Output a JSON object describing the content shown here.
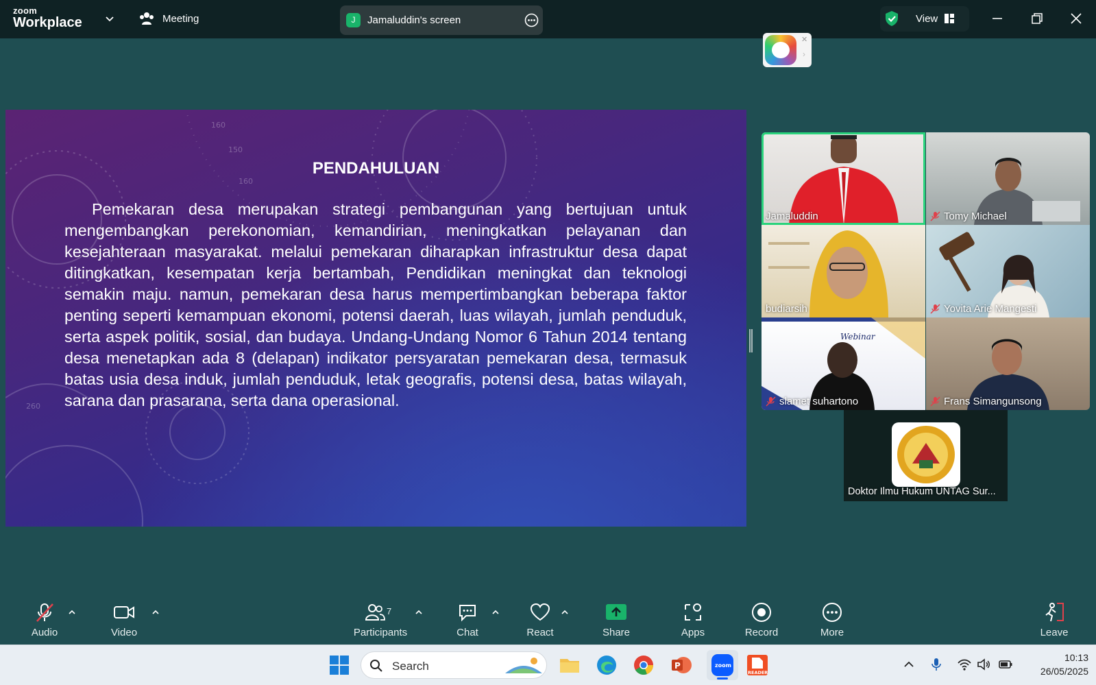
{
  "titlebar": {
    "logo_line1": "zoom",
    "logo_line2": "Workplace",
    "meeting_label": "Meeting",
    "share_badge": "J",
    "share_title": "Jamaluddin's screen",
    "view_label": "View"
  },
  "slide": {
    "title": "PENDAHULUAN",
    "body": "Pemekaran desa merupakan strategi pembangunan yang bertujuan untuk mengembangkan perekonomian, kemandirian, meningkatkan pelayanan dan kesejahteraan masyarakat. melalui pemekaran diharapkan infrastruktur desa dapat ditingkatkan, kesempatan kerja bertambah, Pendidikan meningkat dan teknologi semakin maju. namun, pemekaran desa harus mempertimbangkan beberapa faktor penting seperti kemampuan ekonomi, potensi daerah, luas wilayah, jumlah penduduk, serta aspek politik, sosial, dan budaya. Undang-Undang Nomor 6 Tahun 2014 tentang desa menetapkan ada 8 (delapan) indikator persyaratan pemekaran desa, termasuk batas usia desa induk, jumlah penduduk, letak geografis, potensi desa, batas wilayah, sarana dan prasarana, serta dana operasional.",
    "deco_numbers": [
      "160",
      "150",
      "160",
      "260"
    ]
  },
  "participants": [
    {
      "name": "Jamaluddin",
      "muted": false,
      "active": true
    },
    {
      "name": "Tomy Michael",
      "muted": true,
      "active": false
    },
    {
      "name": "budiarsih",
      "muted": false,
      "active": false
    },
    {
      "name": "Yovita Arie Mangesti",
      "muted": true,
      "active": false
    },
    {
      "name": "slamet suhartono",
      "muted": true,
      "active": false
    },
    {
      "name": "Frans Simangunsong",
      "muted": true,
      "active": false
    },
    {
      "name": "Doktor Ilmu Hukum UNTAG Sur...",
      "muted": false,
      "active": false
    }
  ],
  "webinar_tile_text": "Webinar",
  "toolbar": {
    "audio": "Audio",
    "video": "Video",
    "participants": "Participants",
    "participants_count": "7",
    "chat": "Chat",
    "react": "React",
    "share": "Share",
    "apps": "Apps",
    "record": "Record",
    "more": "More",
    "leave": "Leave"
  },
  "taskbar": {
    "search_placeholder": "Search",
    "time": "10:13",
    "date": "26/05/2025",
    "zoom_app_label": "zoom",
    "reader_app_label": "READER"
  },
  "colors": {
    "meeting_bg": "#1f4e52",
    "titlebar_bg": "#0f2224",
    "active_speaker": "#2ad37c",
    "share_green": "#19b36a",
    "mute_red": "#e0414b"
  }
}
